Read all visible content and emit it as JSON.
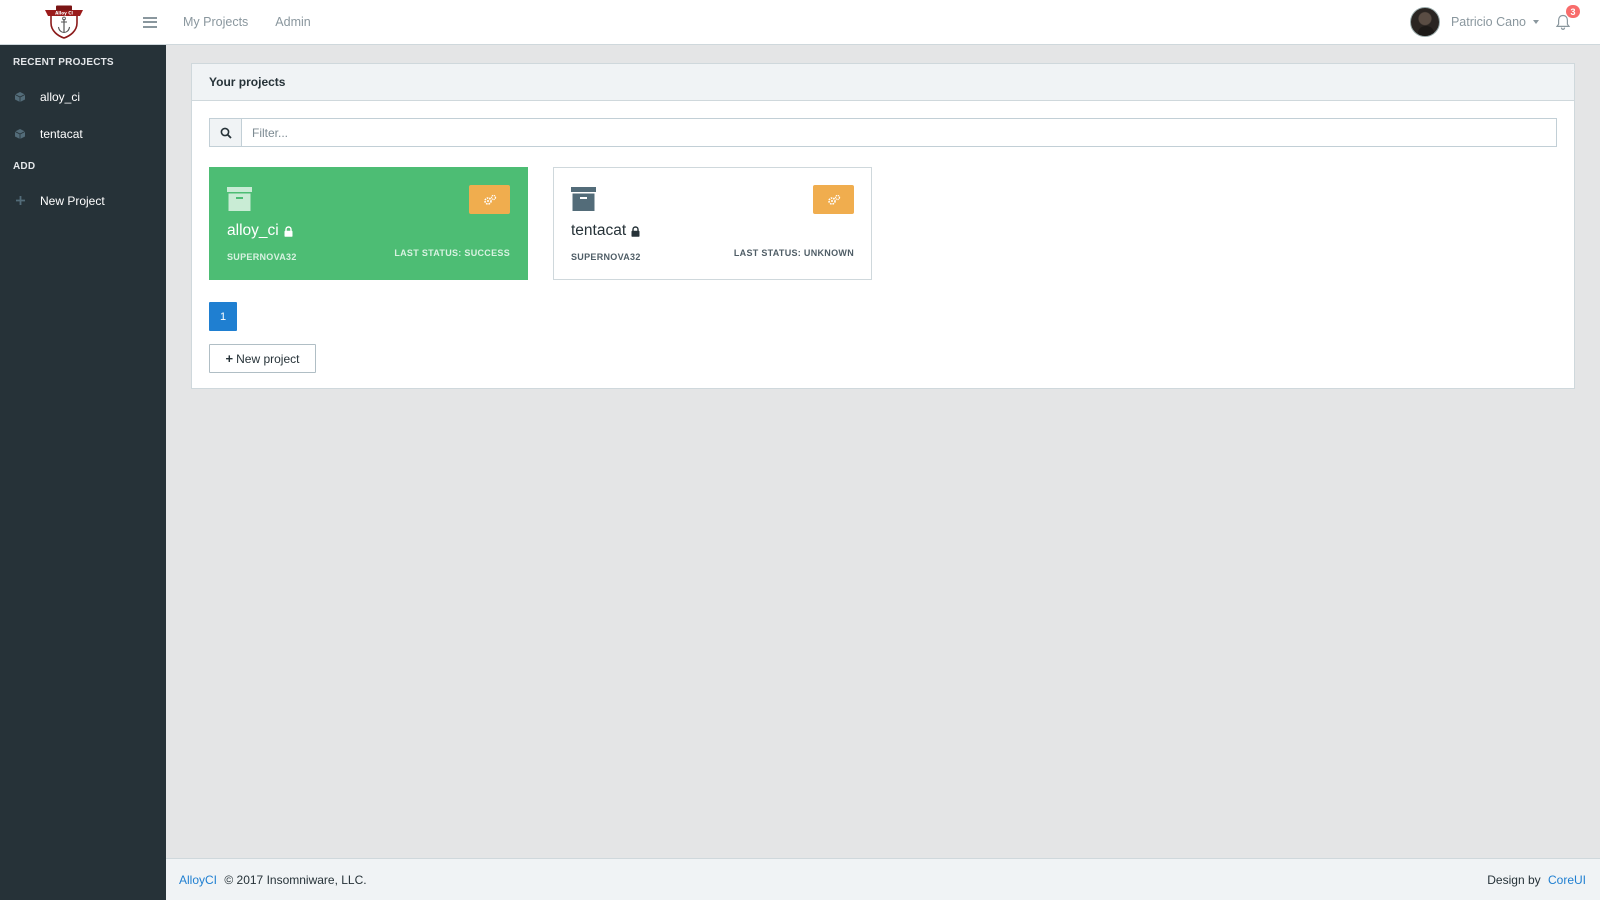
{
  "header": {
    "logo_text": "Alloy CI",
    "nav": [
      {
        "label": "My Projects"
      },
      {
        "label": "Admin"
      }
    ],
    "user_name": "Patricio Cano",
    "notification_count": "3"
  },
  "sidebar": {
    "recent_title": "RECENT PROJECTS",
    "recent_items": [
      {
        "label": "alloy_ci"
      },
      {
        "label": "tentacat"
      }
    ],
    "add_title": "ADD",
    "add_items": [
      {
        "label": "New Project"
      }
    ]
  },
  "main": {
    "card_title": "Your projects",
    "filter_placeholder": "Filter...",
    "projects": [
      {
        "name": "alloy_ci",
        "owner": "SUPERNOVA32",
        "status": "LAST STATUS: SUCCESS",
        "status_color": "#4dbd74"
      },
      {
        "name": "tentacat",
        "owner": "SUPERNOVA32",
        "status": "LAST STATUS: UNKNOWN",
        "status_color": "#ffffff"
      }
    ],
    "pagination_current": "1",
    "new_project_label": "New project"
  },
  "footer": {
    "brand_link": "AlloyCI",
    "copyright": "© 2017 Insomniware, LLC.",
    "design_by": "Design by",
    "design_link": "CoreUI"
  },
  "colors": {
    "sidebar_bg": "#263238",
    "success": "#4dbd74",
    "warning": "#f0ad4e",
    "primary": "#1f7fd1",
    "badge": "#f86c6b"
  }
}
